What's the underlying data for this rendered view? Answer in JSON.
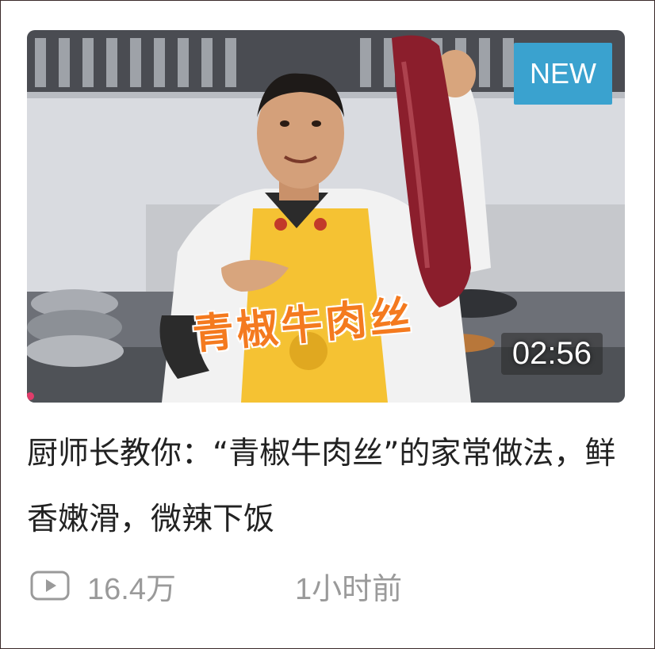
{
  "card": {
    "badge": "NEW",
    "overlay_text": "青椒牛肉丝",
    "duration": "02:56",
    "title": "厨师长教你：“青椒牛肉丝”的家常做法，鲜香嫩滑，微辣下饭",
    "views": "16.4万",
    "time_ago": "1小时前",
    "play_icon": "play-icon"
  },
  "colors": {
    "badge_bg": "#3aa2cf",
    "overlay_text": "#f47a1f",
    "title_text": "#222222",
    "meta_text": "#9a9a9a",
    "apron": "#f5c233",
    "beef": "#8b1e2c"
  }
}
